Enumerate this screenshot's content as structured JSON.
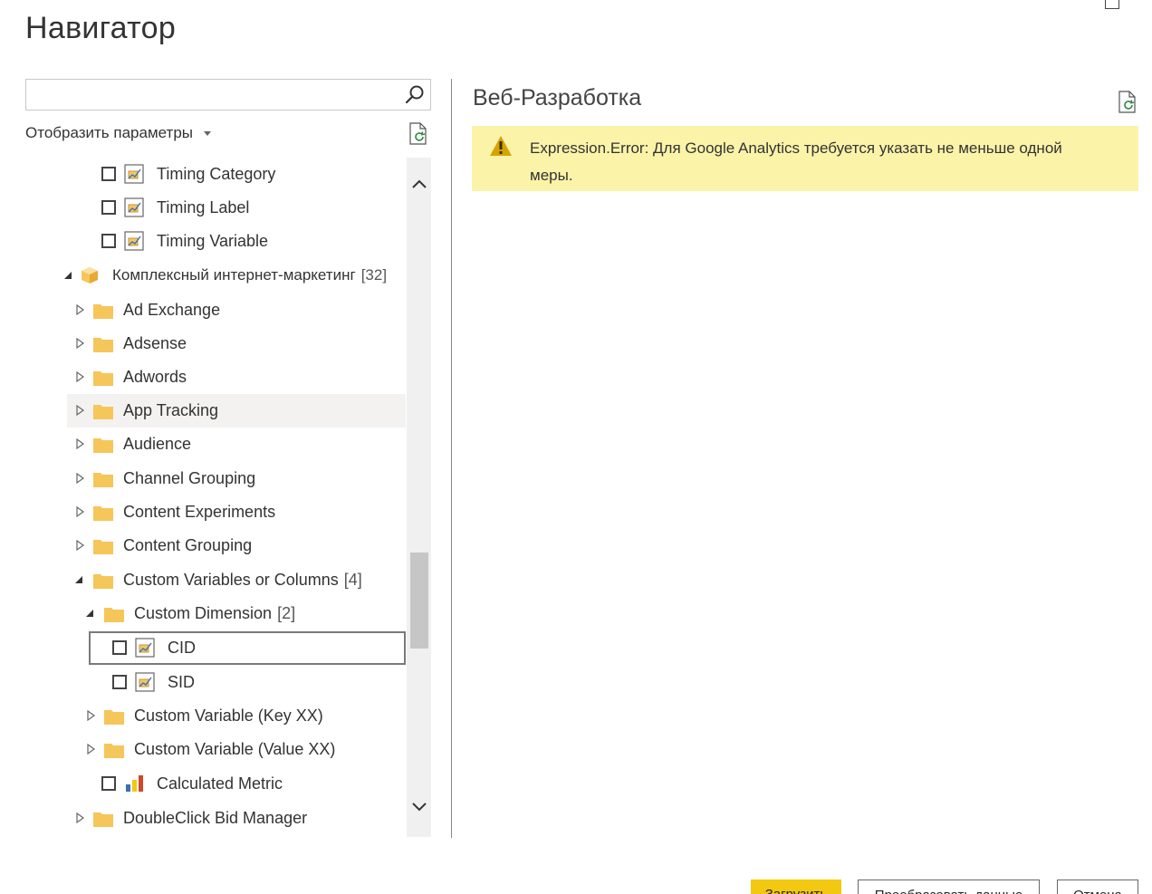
{
  "window": {
    "title": "Навигатор"
  },
  "search": {
    "value": "",
    "placeholder": ""
  },
  "display_options": {
    "label": "Отобразить параметры"
  },
  "tree": {
    "items": [
      {
        "type": "field",
        "label": "Timing Category"
      },
      {
        "type": "field",
        "label": "Timing Label"
      },
      {
        "type": "field",
        "label": "Timing Variable"
      },
      {
        "type": "cube",
        "label": "Комплексный интернет-маркетинг",
        "count": "[32]",
        "expanded": true
      },
      {
        "type": "folder",
        "label": "Ad Exchange"
      },
      {
        "type": "folder",
        "label": "Adsense"
      },
      {
        "type": "folder",
        "label": "Adwords"
      },
      {
        "type": "folder",
        "label": "App Tracking",
        "hovered": true
      },
      {
        "type": "folder",
        "label": "Audience"
      },
      {
        "type": "folder",
        "label": "Channel Grouping"
      },
      {
        "type": "folder",
        "label": "Content Experiments"
      },
      {
        "type": "folder",
        "label": "Content Grouping"
      },
      {
        "type": "folder",
        "label": "Custom Variables or Columns",
        "count": "[4]",
        "expanded": true
      },
      {
        "type": "folder",
        "label": "Custom Dimension",
        "count": "[2]",
        "expanded": true
      },
      {
        "type": "field",
        "label": "CID",
        "selected": true
      },
      {
        "type": "field",
        "label": "SID"
      },
      {
        "type": "folder",
        "label": "Custom Variable (Key XX)"
      },
      {
        "type": "folder",
        "label": "Custom Variable (Value XX)"
      },
      {
        "type": "measure",
        "label": "Calculated Metric"
      },
      {
        "type": "folder",
        "label": "DoubleClick Bid Manager"
      }
    ]
  },
  "preview": {
    "title": "Веб-Разработка",
    "error": "Expression.Error: Для Google Analytics требуется указать не меньше одной меры."
  },
  "footer": {
    "load_label": "Загрузить",
    "transform_label": "Преобразовать данные",
    "cancel_label": "Отмена"
  },
  "colors": {
    "accent": "#f2c811",
    "folder": "#f5c65a",
    "error_banner": "#fbf3a8",
    "warning": "#d7a300"
  },
  "icons": {
    "search": "search-icon",
    "refresh": "refresh-icon",
    "warning": "warning-icon",
    "folder": "folder-icon",
    "cube": "cube-icon",
    "field": "dimension-field-icon",
    "measure": "bar-chart-icon"
  }
}
